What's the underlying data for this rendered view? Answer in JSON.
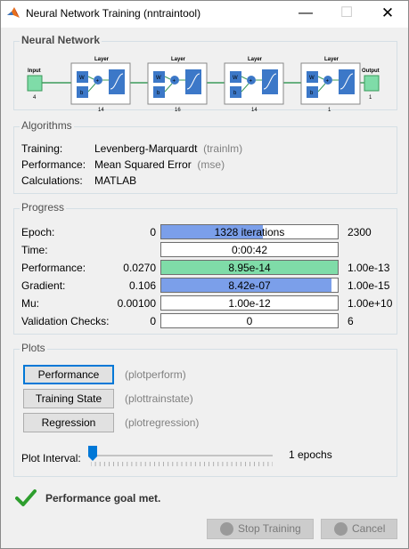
{
  "window": {
    "title": "Neural Network Training (nntraintool)"
  },
  "network": {
    "section_title": "Neural Network",
    "input_label": "Input",
    "input_size": "4",
    "layer_label": "Layer",
    "w_label": "W",
    "b_label": "b",
    "layer_sizes": [
      "14",
      "16",
      "14",
      "1"
    ],
    "output_label": "Output",
    "output_size": "1"
  },
  "algorithms": {
    "section_title": "Algorithms",
    "training_label": "Training:",
    "training_value": "Levenberg-Marquardt",
    "training_fn": "(trainlm)",
    "performance_label": "Performance:",
    "performance_value": "Mean Squared Error",
    "performance_fn": "(mse)",
    "calculations_label": "Calculations:",
    "calculations_value": "MATLAB"
  },
  "progress": {
    "section_title": "Progress",
    "rows": [
      {
        "label": "Epoch:",
        "start": "0",
        "text": "1328 iterations",
        "end": "2300",
        "fill": 0.577,
        "color": "#7b9fea"
      },
      {
        "label": "Time:",
        "start": "",
        "text": "0:00:42",
        "end": "",
        "fill": 0,
        "color": "#7b9fea"
      },
      {
        "label": "Performance:",
        "start": "0.0270",
        "text": "8.95e-14",
        "end": "1.00e-13",
        "fill": 1.0,
        "color": "#7fdca8"
      },
      {
        "label": "Gradient:",
        "start": "0.106",
        "text": "8.42e-07",
        "end": "1.00e-15",
        "fill": 0.965,
        "color": "#7b9fea"
      },
      {
        "label": "Mu:",
        "start": "0.00100",
        "text": "1.00e-12",
        "end": "1.00e+10",
        "fill": 0,
        "color": "#7b9fea"
      },
      {
        "label": "Validation Checks:",
        "start": "0",
        "text": "0",
        "end": "6",
        "fill": 0,
        "color": "#7b9fea"
      }
    ]
  },
  "plots": {
    "section_title": "Plots",
    "buttons": [
      {
        "label": "Performance",
        "fn": "(plotperform)"
      },
      {
        "label": "Training State",
        "fn": "(plottrainstate)"
      },
      {
        "label": "Regression",
        "fn": "(plotregression)"
      }
    ],
    "interval_label": "Plot Interval:",
    "interval_value": "1 epochs"
  },
  "status": {
    "text": "Performance goal met."
  },
  "buttons": {
    "stop": "Stop Training",
    "cancel": "Cancel"
  },
  "colors": {
    "accent": "#0078d7",
    "check": "#2e9e2e",
    "progress_blue": "#7b9fea",
    "progress_green": "#7fdca8"
  }
}
